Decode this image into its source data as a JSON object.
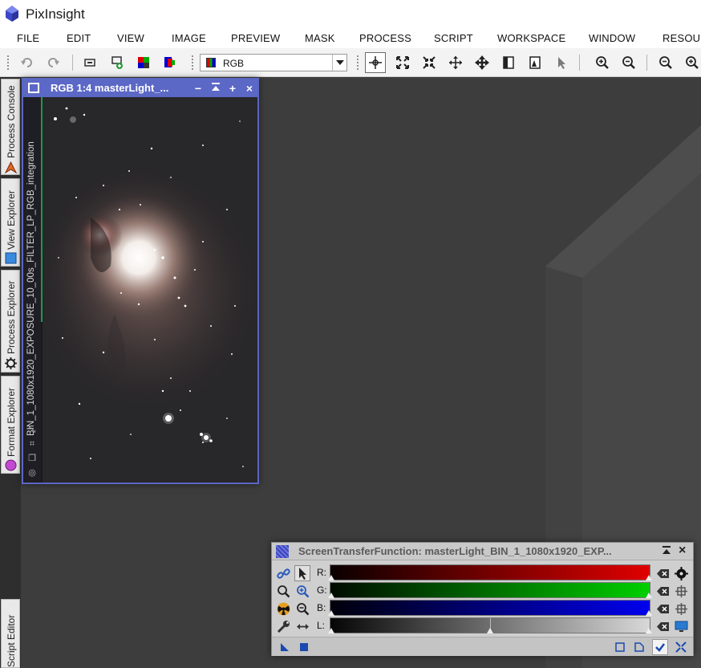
{
  "app": {
    "title": "PixInsight"
  },
  "menu": [
    "FILE",
    "EDIT",
    "VIEW",
    "IMAGE",
    "PREVIEW",
    "MASK",
    "PROCESS",
    "SCRIPT",
    "WORKSPACE",
    "WINDOW",
    "RESOUR"
  ],
  "toolbar": {
    "color_mode": "RGB"
  },
  "sidebar": {
    "tabs": [
      "Process Console",
      "View Explorer",
      "Process Explorer",
      "Format Explorer",
      "Script Editor"
    ]
  },
  "image_window": {
    "title": "RGB 1:4 masterLight_...",
    "view_id": "BIN_1_1080x1920_EXPOSURE_10_00s_FILTER_LP_RGB_integration"
  },
  "stf": {
    "title": "ScreenTransferFunction: masterLight_BIN_1_1080x1920_EXP...",
    "channels": [
      {
        "label": "R:",
        "color": "#e00000",
        "midtone": 0.0
      },
      {
        "label": "G:",
        "color": "#00d000",
        "midtone": 0.0
      },
      {
        "label": "B:",
        "color": "#0000ee",
        "midtone": 0.0
      },
      {
        "label": "L:",
        "color": "#d8d8d8",
        "midtone": 0.5
      }
    ]
  },
  "colors": {
    "window_title": "#5b68c6",
    "workspace": "#3d3d3d",
    "accent_green": "#1d9a4c"
  }
}
